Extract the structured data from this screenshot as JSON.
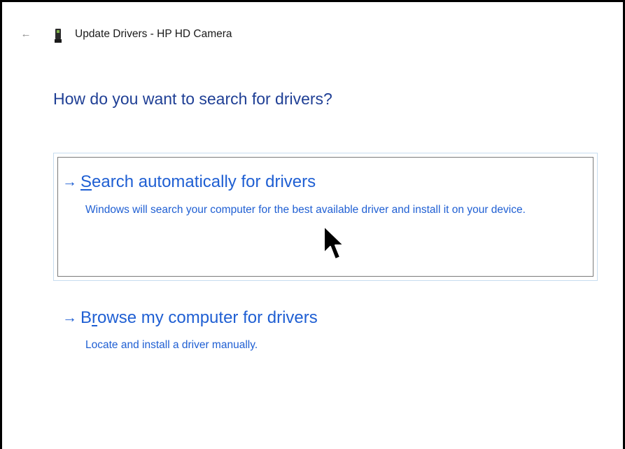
{
  "window": {
    "back_icon": "back-arrow-icon",
    "device_icon": "camera-device-icon",
    "title": "Update Drivers - HP HD Camera"
  },
  "main": {
    "heading": "How do you want to search for drivers?",
    "options": [
      {
        "arrow": "→",
        "accel_letter": "S",
        "title_rest": "earch automatically for drivers",
        "description": "Windows will search your computer for the best available driver and install it on your device.",
        "focused": true
      },
      {
        "arrow": "→",
        "title_first": "B",
        "accel_letter": "r",
        "title_rest": "owse my computer for drivers",
        "description": "Locate and install a driver manually.",
        "focused": false
      }
    ]
  },
  "colors": {
    "heading": "#1f3f95",
    "link": "#1f5fd3",
    "focus_outer": "#c7ddef",
    "focus_inner": "#7a7a7a"
  },
  "mouse_cursor_icon": "arrow-pointer-icon"
}
